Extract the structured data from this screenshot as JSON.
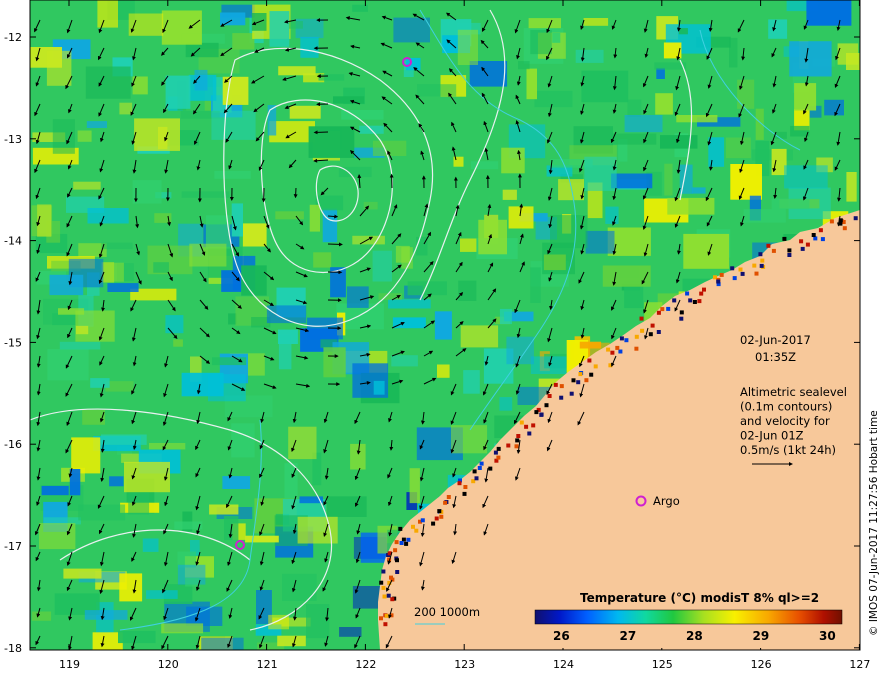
{
  "map": {
    "date": "02-Jun-2017",
    "time": "01:35Z",
    "info_lines": [
      "Altimetric sealevel",
      "(0.1m contours)",
      "and velocity for",
      "02-Jun 01Z",
      "0.5m/s (1kt 24h)"
    ],
    "float_label": "Argo",
    "isobaths_label": "200  1000m",
    "colorbar": {
      "title": "Temperature (°C) modisT 8% ql>=2",
      "ticks": [
        "26",
        "27",
        "28",
        "29",
        "30"
      ],
      "colors": [
        "#10106e",
        "#0018c8",
        "#0060ff",
        "#00b8f0",
        "#10d8a0",
        "#20c840",
        "#a8e020",
        "#f8f000",
        "#f8a800",
        "#e85000",
        "#b01000",
        "#701000"
      ]
    },
    "credit": "© IMOS 07-Jun-2017 11:27:56 Hobart time",
    "lat_ticks": [
      "-12",
      "-13",
      "-14",
      "-15",
      "-16",
      "-17",
      "-18"
    ],
    "lon_ticks": [
      "119",
      "120",
      "121",
      "122",
      "123",
      "124",
      "125",
      "126",
      "127"
    ],
    "colors": {
      "land": "#f7c89a",
      "argo": "#d020d0",
      "isobath_200": "#40d0e0",
      "ssh_contour": "#e8f0f0"
    }
  }
}
